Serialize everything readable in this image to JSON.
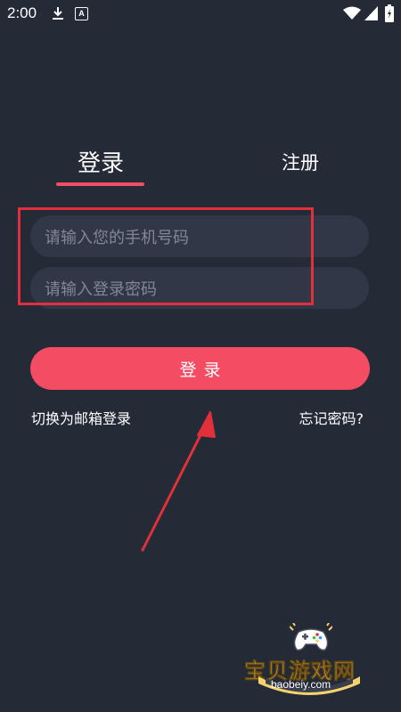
{
  "status_bar": {
    "time": "2:00",
    "a_badge": "A"
  },
  "tabs": [
    {
      "label": "登录",
      "active": true
    },
    {
      "label": "注册",
      "active": false
    }
  ],
  "form": {
    "phone_placeholder": "请输入您的手机号码",
    "password_placeholder": "请输入登录密码"
  },
  "login_button": {
    "label": "登录"
  },
  "links": {
    "switch_email": "切换为邮箱登录",
    "forgot_password": "忘记密码?"
  },
  "watermark": {
    "title": "宝贝游戏网",
    "url": "baobeiy.com"
  },
  "colors": {
    "background": "#252a37",
    "input_bg": "#323747",
    "accent": "#f44d63",
    "annotation": "#e0303a"
  }
}
